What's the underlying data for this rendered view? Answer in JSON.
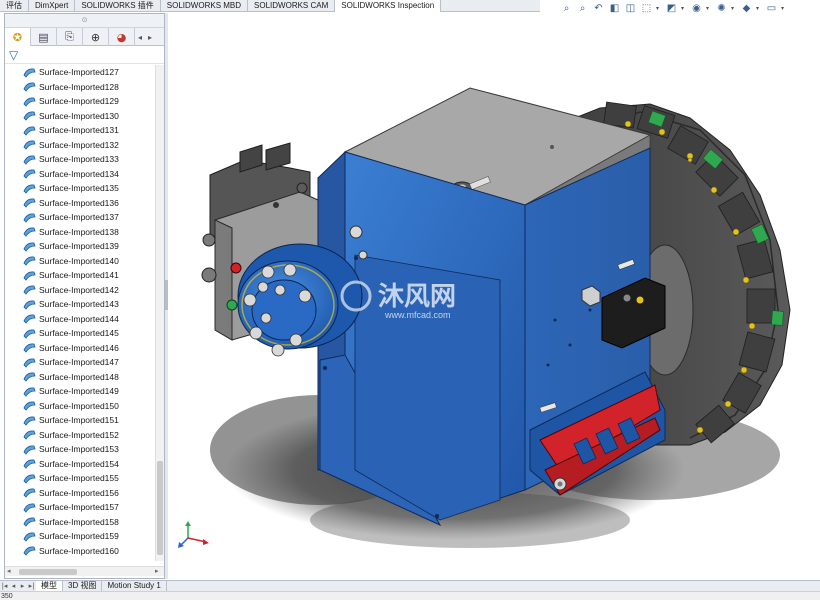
{
  "command_tabs": [
    {
      "label": "评估",
      "active": false
    },
    {
      "label": "DimXpert",
      "active": false
    },
    {
      "label": "SOLIDWORKS 插件",
      "active": false
    },
    {
      "label": "SOLIDWORKS MBD",
      "active": false
    },
    {
      "label": "SOLIDWORKS CAM",
      "active": false
    },
    {
      "label": "SOLIDWORKS Inspection",
      "active": true
    }
  ],
  "view_toolbar": {
    "icons": [
      "zoom-to-fit-icon",
      "zoom-to-area-icon",
      "previous-view-icon",
      "section-view-icon",
      "dynamic-annotation-icon",
      "view-orientation-icon",
      "display-style-icon",
      "hide-show-items-icon",
      "edit-appearance-icon",
      "apply-scene-icon",
      "view-settings-icon"
    ]
  },
  "panel_tabs": [
    {
      "name": "feature-manager-tab",
      "icon": "feature-tree-icon",
      "active": true
    },
    {
      "name": "property-manager-tab",
      "icon": "property-manager-icon",
      "active": false
    },
    {
      "name": "configuration-manager-tab",
      "icon": "configuration-icon",
      "active": false
    },
    {
      "name": "dimxpert-manager-tab",
      "icon": "dimxpert-icon",
      "active": false
    },
    {
      "name": "display-manager-tab",
      "icon": "display-manager-icon",
      "active": false
    }
  ],
  "tree": {
    "items": [
      "Surface-Imported127",
      "Surface-Imported128",
      "Surface-Imported129",
      "Surface-Imported130",
      "Surface-Imported131",
      "Surface-Imported132",
      "Surface-Imported133",
      "Surface-Imported134",
      "Surface-Imported135",
      "Surface-Imported136",
      "Surface-Imported137",
      "Surface-Imported138",
      "Surface-Imported139",
      "Surface-Imported140",
      "Surface-Imported141",
      "Surface-Imported142",
      "Surface-Imported143",
      "Surface-Imported144",
      "Surface-Imported145",
      "Surface-Imported146",
      "Surface-Imported147",
      "Surface-Imported148",
      "Surface-Imported149",
      "Surface-Imported150",
      "Surface-Imported151",
      "Surface-Imported152",
      "Surface-Imported153",
      "Surface-Imported154",
      "Surface-Imported155",
      "Surface-Imported156",
      "Surface-Imported157",
      "Surface-Imported158",
      "Surface-Imported159",
      "Surface-Imported160"
    ]
  },
  "watermark": {
    "brand": "沐风网",
    "url": "www.mfcad.com"
  },
  "bottom_tabs": [
    {
      "label": "模型",
      "active": true
    },
    {
      "label": "3D 视图",
      "active": false
    },
    {
      "label": "Motion Study 1",
      "active": false
    }
  ],
  "status": {
    "text": "350"
  },
  "colors": {
    "housing_blue": "#2f6fc4",
    "accent_red": "#d2232a",
    "turret_dark": "#4a4a4a",
    "tool_green": "#2fa84f",
    "top_plate": "#9a9a9a"
  }
}
